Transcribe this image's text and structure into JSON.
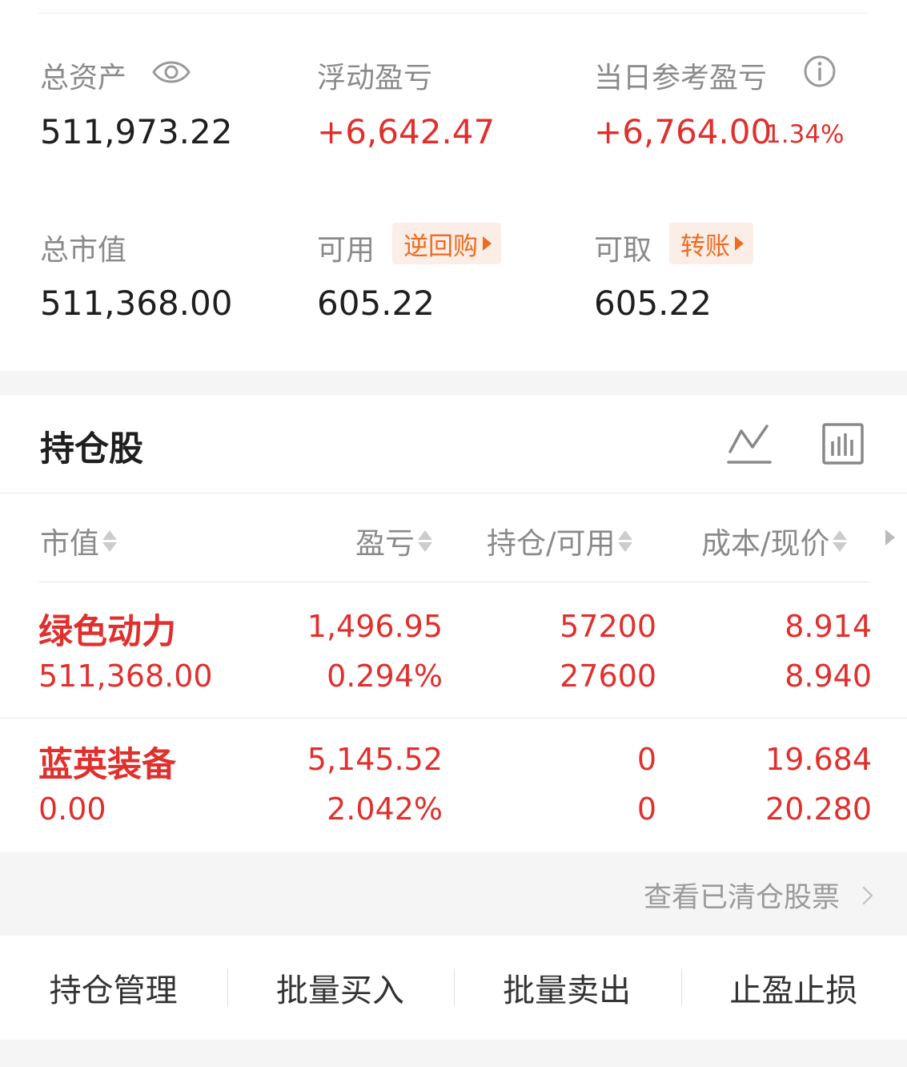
{
  "summary": {
    "total_assets_label": "总资产",
    "total_assets_value": "511,973.22",
    "floating_pl_label": "浮动盈亏",
    "floating_pl_value": "+6,642.47",
    "daily_pl_label": "当日参考盈亏",
    "daily_pl_value": "+6,764.00",
    "daily_pl_pct": "1.34%",
    "market_value_label": "总市值",
    "market_value_value": "511,368.00",
    "available_label": "可用",
    "available_value": "605.22",
    "reverse_repo_btn": "逆回购",
    "withdrawable_label": "可取",
    "withdrawable_value": "605.22",
    "transfer_btn": "转账"
  },
  "holdings": {
    "title": "持仓股",
    "columns": [
      "市值",
      "盈亏",
      "持仓/可用",
      "成本/现价"
    ],
    "rows": [
      {
        "name": "绿色动力",
        "market_value": "511,368.00",
        "pl": "1,496.95",
        "pl_pct": "0.294%",
        "position": "57200",
        "available": "27600",
        "cost": "8.914",
        "price": "8.940"
      },
      {
        "name": "蓝英装备",
        "market_value": "0.00",
        "pl": "5,145.52",
        "pl_pct": "2.042%",
        "position": "0",
        "available": "0",
        "cost": "19.684",
        "price": "20.280"
      }
    ],
    "cleared_link": "查看已清仓股票"
  },
  "actions": [
    "持仓管理",
    "批量买入",
    "批量卖出",
    "止盈止损"
  ],
  "colors": {
    "up_red": "#e0302d",
    "accent_orange": "#ef6a22",
    "label_gray": "#8a8a8a",
    "band_gray": "#f5f5f5"
  },
  "icons": [
    "eye-icon",
    "info-icon",
    "line-chart-icon",
    "bar-chart-icon",
    "sort-icon",
    "chevron-right-icon"
  ]
}
